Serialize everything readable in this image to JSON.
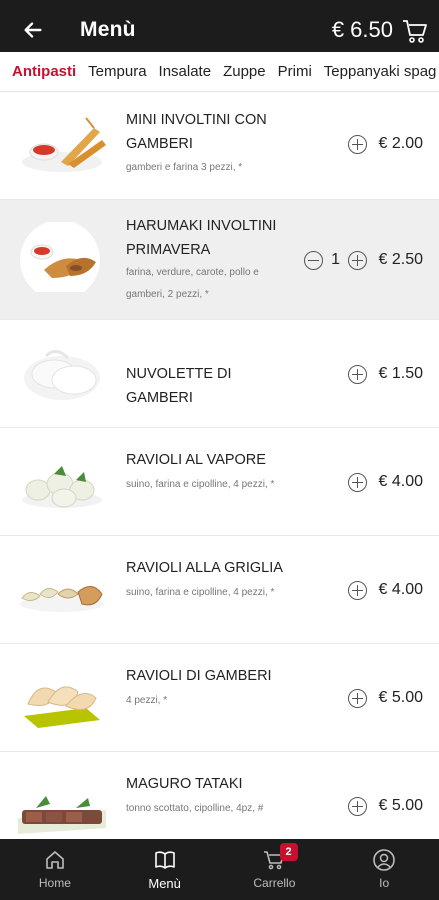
{
  "header": {
    "title": "Menù",
    "total": "€ 6.50"
  },
  "tabs": [
    "Antipasti",
    "Tempura",
    "Insalate",
    "Zuppe",
    "Primi",
    "Teppanyaki spag"
  ],
  "items": [
    {
      "name": "MINI INVOLTINI CON GAMBERI",
      "desc": "gamberi e farina 3 pezzi, *",
      "qty": "",
      "price": "€ 2.00"
    },
    {
      "name": "HARUMAKI INVOLTINI PRIMAVERA",
      "desc": "farina, verdure, carote, pollo e gamberi, 2 pezzi, *",
      "qty": "1",
      "price": "€ 2.50"
    },
    {
      "name": "NUVOLETTE DI GAMBERI",
      "desc": "",
      "qty": "",
      "price": "€ 1.50"
    },
    {
      "name": "RAVIOLI AL VAPORE",
      "desc": "suino, farina e cipolline, 4 pezzi, *",
      "qty": "",
      "price": "€ 4.00"
    },
    {
      "name": "RAVIOLI ALLA GRIGLIA",
      "desc": "suino, farina e cipolline, 4 pezzi, *",
      "qty": "",
      "price": "€ 4.00"
    },
    {
      "name": "RAVIOLI DI GAMBERI",
      "desc": "4 pezzi, *",
      "qty": "",
      "price": "€ 5.00"
    },
    {
      "name": "MAGURO TATAKI",
      "desc": "tonno scottato, cipolline, 4pz, #",
      "qty": "",
      "price": "€ 5.00"
    }
  ],
  "nav": {
    "home": "Home",
    "menu": "Menù",
    "cart": "Carrello",
    "cart_badge": "2",
    "me": "Io"
  },
  "colors": {
    "accent": "#c8102e",
    "bar": "#1c1c1c",
    "selected_row": "#efefef"
  }
}
